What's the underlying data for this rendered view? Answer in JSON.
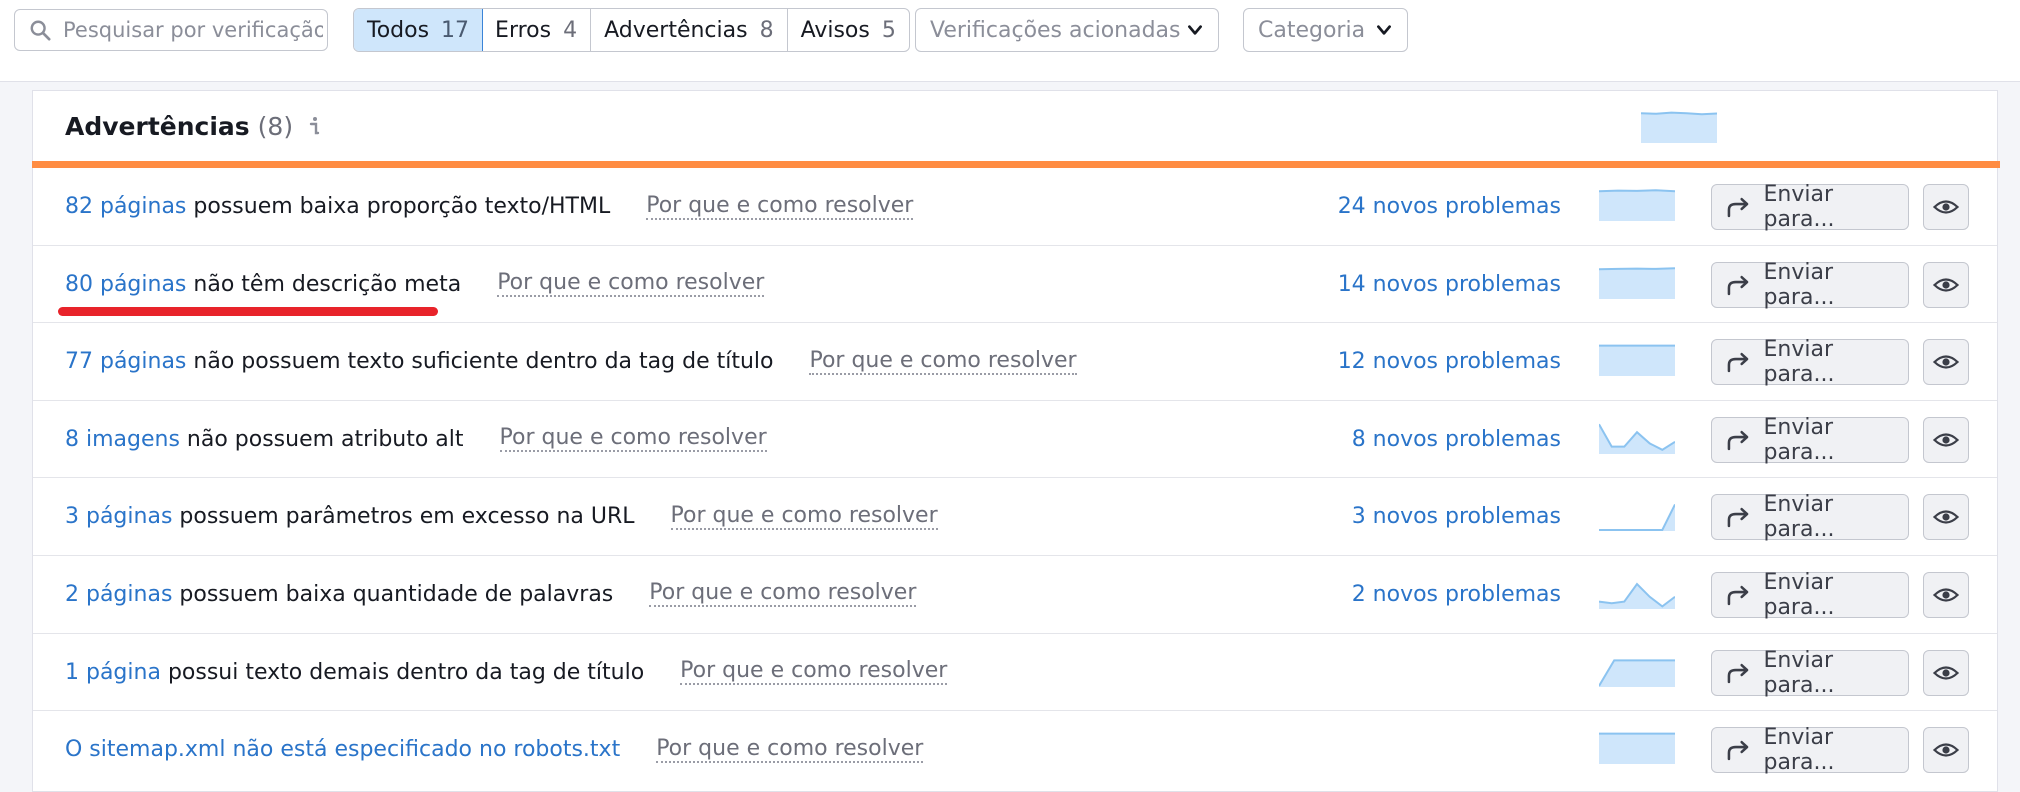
{
  "search": {
    "placeholder": "Pesquisar por verificação"
  },
  "tabs": [
    {
      "label": "Todos",
      "count": "17",
      "active": true
    },
    {
      "label": "Erros",
      "count": "4"
    },
    {
      "label": "Advertências",
      "count": "8"
    },
    {
      "label": "Avisos",
      "count": "5"
    }
  ],
  "filters": {
    "triggered": "Verificações acionadas",
    "category": "Categoria"
  },
  "panel": {
    "title": "Advertências",
    "count": "(8)"
  },
  "colors": {
    "accent_orange": "#ff8c42",
    "link_blue": "#2a74c9",
    "spark_fill": "#cfe6fb",
    "spark_line": "#8bc3f0",
    "highlight_red": "#e8232a"
  },
  "rows": [
    {
      "link": "82 páginas",
      "desc": "possuem baixa proporção texto/HTML",
      "why": "Por que e como resolver",
      "issues": "24 novos problemas",
      "send": "Enviar para...",
      "spark": [
        0.9,
        0.92,
        0.91,
        0.93,
        0.9
      ]
    },
    {
      "link": "80 páginas",
      "desc": "não têm descrição meta",
      "why": "Por que e como resolver",
      "issues": "14 novos problemas",
      "send": "Enviar para...",
      "spark": [
        0.9,
        0.91,
        0.92,
        0.91,
        0.93
      ]
    },
    {
      "link": "77 páginas",
      "desc": "não possuem texto suficiente dentro da tag de título",
      "why": "Por que e como resolver",
      "issues": "12 novos problemas",
      "send": "Enviar para...",
      "spark": [
        0.92,
        0.92,
        0.92,
        0.92,
        0.92
      ]
    },
    {
      "link": "8 imagens",
      "desc": "não possuem atributo alt",
      "why": "Por que e como resolver",
      "issues": "8 novos problemas",
      "send": "Enviar para...",
      "spark": [
        0.9,
        0.2,
        0.2,
        0.65,
        0.3,
        0.1,
        0.35
      ]
    },
    {
      "link": "3 páginas",
      "desc": "possuem parâmetros em excesso na URL",
      "why": "Por que e como resolver",
      "issues": "3 novos problemas",
      "send": "Enviar para...",
      "spark": [
        0.0,
        0.0,
        0.0,
        0.0,
        0.0,
        0.0,
        0.8
      ]
    },
    {
      "link": "2 páginas",
      "desc": "possuem baixa quantidade de palavras",
      "why": "Por que e como resolver",
      "issues": "2 novos problemas",
      "send": "Enviar para...",
      "spark": [
        0.2,
        0.15,
        0.2,
        0.75,
        0.35,
        0.05,
        0.35
      ]
    },
    {
      "link": "1 página",
      "desc": "possui texto demais dentro da tag de título",
      "why": "Por que e como resolver",
      "issues": "",
      "send": "Enviar para...",
      "spark": [
        0.0,
        0.8,
        0.8,
        0.8,
        0.8,
        0.8
      ]
    },
    {
      "link": "O sitemap.xml não está especificado no robots.txt",
      "desc": "",
      "why": "Por que e como resolver",
      "issues": "",
      "send": "Enviar para...",
      "spark": [
        0.92,
        0.92,
        0.92,
        0.92,
        0.92
      ]
    }
  ],
  "header_spark": [
    0.9,
    0.88,
    0.92,
    0.9,
    0.87,
    0.89
  ]
}
